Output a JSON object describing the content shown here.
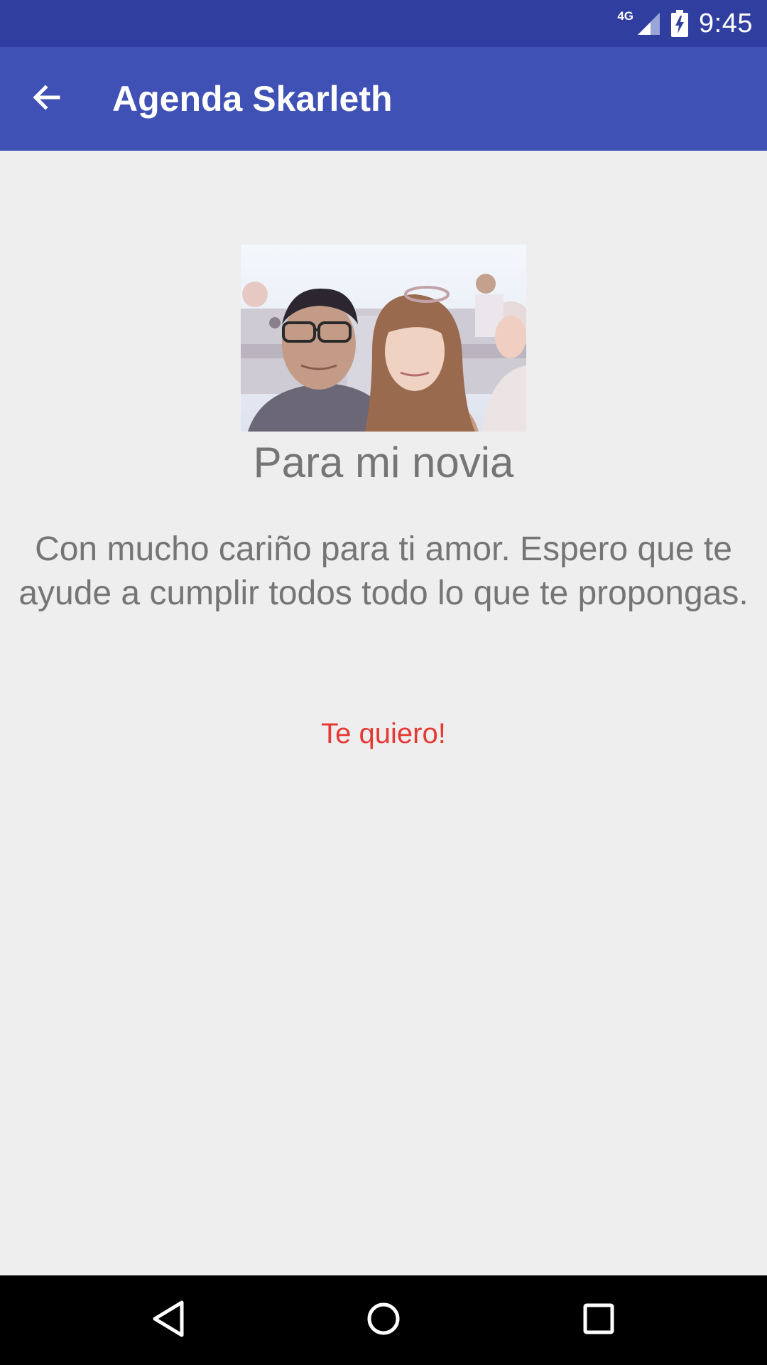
{
  "status_bar": {
    "network": "4G",
    "time": "9:45",
    "icons": [
      "signal-icon",
      "battery-charging-icon"
    ]
  },
  "app_bar": {
    "title": "Agenda Skarleth",
    "back_icon": "arrow-back-icon"
  },
  "content": {
    "photo": "couple-selfie-image",
    "heading": "Para mi novia",
    "message": "Con mucho cariño para ti amor. Espero que te ayude a cumplir todos todo lo que te propongas.",
    "button_label": "Te quiero!"
  },
  "nav_bar": {
    "icons": [
      "nav-back-icon",
      "nav-home-icon",
      "nav-recents-icon"
    ]
  },
  "colors": {
    "status_bar": "#303f9f",
    "app_bar": "#3f51b5",
    "background": "#eeeeee",
    "text_secondary": "#757575",
    "accent": "#e53935",
    "nav_bar": "#000000"
  }
}
